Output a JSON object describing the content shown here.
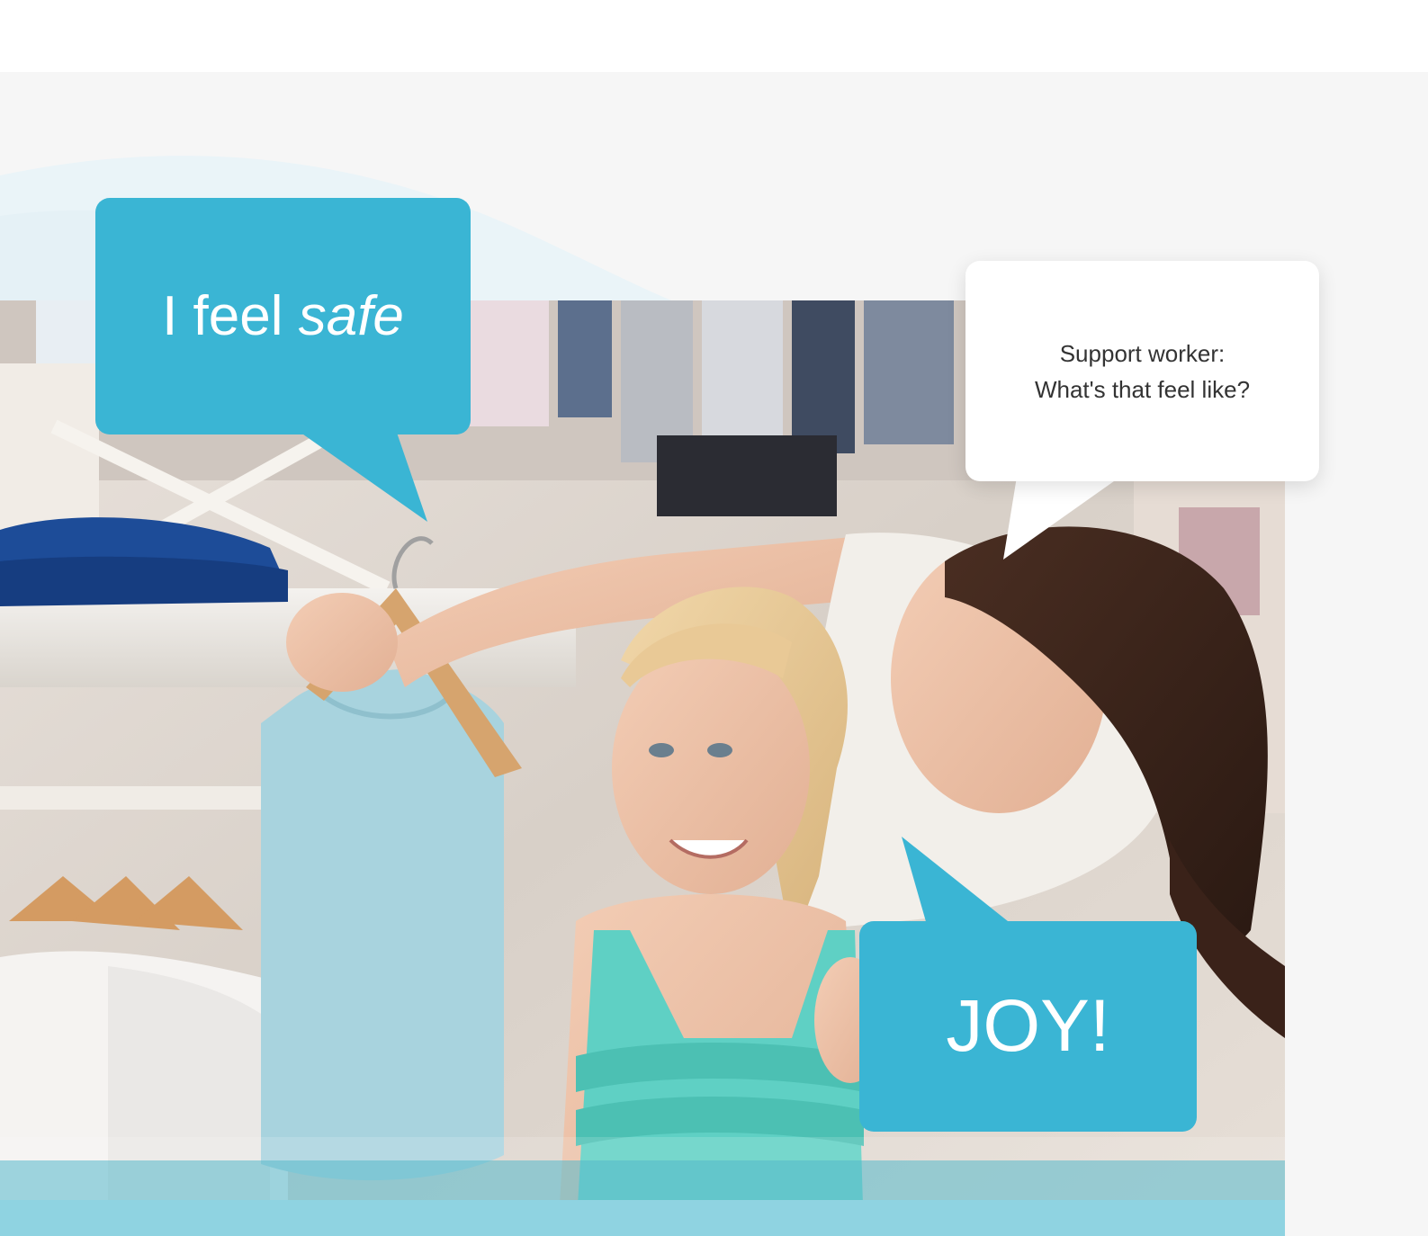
{
  "bubbles": {
    "safe_prefix": "I feel ",
    "safe_emphasis": "safe",
    "support_line1": "Support worker:",
    "support_line2": "What's that feel like?",
    "joy": "JOY!"
  },
  "colors": {
    "accent": "#3ab5d4",
    "section_background": "#f6f6f6",
    "wave": "#e9f3f7",
    "bottom_strip": "#8fd3e1"
  },
  "image": {
    "subject": "woman-and-girl-clothes-shopping-photo"
  }
}
